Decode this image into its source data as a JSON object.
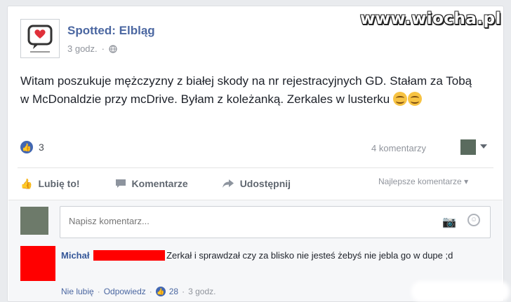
{
  "watermark": "www.wiocha.pl",
  "post": {
    "page_name": "Spotted: Elbląg",
    "time": "3 godz.",
    "meta_separator": "·",
    "globe_icon": "globe-icon",
    "text": "Witam poszukuje mężczyzny z białej skody na nr rejestracyjnych GD. Stałam za Tobą w McDonaldzie przy mcDrive. Byłam z koleżanką. Zerkales w lusterku",
    "emoji_icon": "smiling-face-icon",
    "reactions_count": "3",
    "comments_count": "4 komentarzy"
  },
  "actions": {
    "like": "Lubię to!",
    "comment": "Komentarze",
    "share": "Udostępnij",
    "sort": "Najlepsze komentarze"
  },
  "composer": {
    "placeholder": "Napisz komentarz..."
  },
  "comment": {
    "author": "Michał",
    "text": "Zerkał i sprawdzał czy za blisko nie jesteś żebyś nie jebla go w dupe ;d",
    "unlike": "Nie lubię",
    "reply": "Odpowiedz",
    "likes": "28",
    "time": "3 godz.",
    "separator": "·"
  },
  "colors": {
    "accent": "#4267b2",
    "page_name": "#4b67a1",
    "redaction": "#ff0000"
  }
}
